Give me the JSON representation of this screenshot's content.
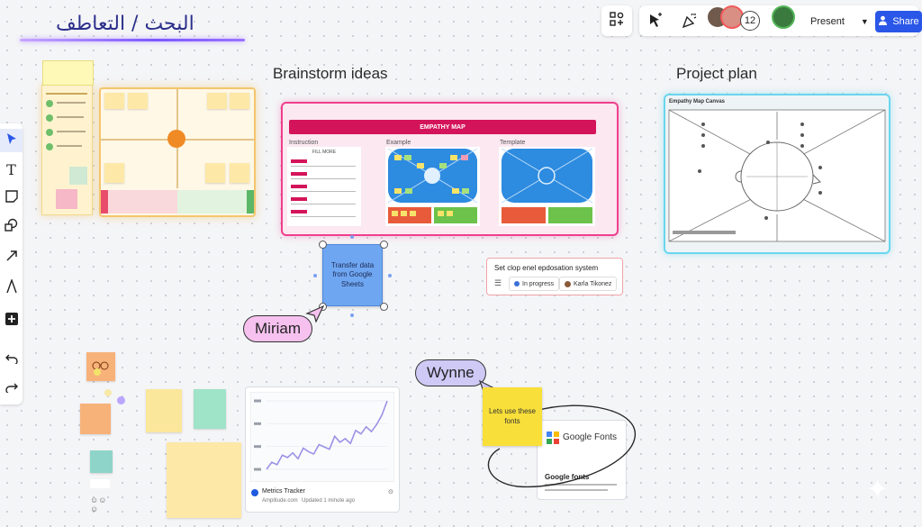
{
  "board": {
    "title": "البحث / التعاطف"
  },
  "toolbar": {
    "participant_count": "12",
    "present_label": "Present",
    "share_label": "Share",
    "icons": [
      "shapes-icon",
      "cursor-select-icon",
      "celebrate-icon"
    ]
  },
  "left_toolbar": {
    "tools": [
      "select-tool",
      "text-tool",
      "sticky-note-tool",
      "shapes-tool",
      "connector-tool",
      "pen-tool",
      "add-tool",
      "undo-tool",
      "redo-tool"
    ]
  },
  "sections": {
    "brainstorm": "Brainstorm ideas",
    "project_plan": "Project plan"
  },
  "empathy_map": {
    "header": "EMPATHY MAP",
    "columns": [
      "Instruction",
      "Example",
      "Template"
    ],
    "fill_more": "FILL MORE"
  },
  "project_canvas": {
    "title": "Empathy Map Canvas"
  },
  "blue_sticky": {
    "text": "Transfer data from Google Sheets"
  },
  "cursors": [
    {
      "name": "Miriam",
      "color": "#f6c1ef"
    },
    {
      "name": "Wynne",
      "color": "#cfc9f6"
    }
  ],
  "task_card": {
    "title": "Set clop enel epdosation system",
    "status": "In progress",
    "assignee": "Karla Tikonez"
  },
  "chart_card": {
    "title": "Metrics Tracker",
    "source": "Amplitude.com",
    "updated": "Updated 1 minute ago"
  },
  "chart_data": {
    "type": "line",
    "x": [
      1,
      2,
      3,
      4,
      5,
      6,
      7,
      8,
      9,
      10,
      11,
      12,
      13,
      14,
      15,
      16,
      17,
      18,
      19,
      20,
      21,
      22,
      23,
      24
    ],
    "series": [
      {
        "values": [
          12,
          18,
          16,
          24,
          22,
          26,
          21,
          30,
          27,
          25,
          33,
          31,
          29,
          40,
          35,
          38,
          34,
          45,
          42,
          48,
          44,
          50,
          58,
          70
        ]
      }
    ],
    "grid": true
  },
  "yellow_sticky": {
    "text": "Lets use these fonts"
  },
  "google_fonts_card": {
    "brand": "Google Fonts",
    "title": "Google fonts"
  },
  "colors": {
    "brainstorm_frame": "#ef3f8e",
    "plan_frame": "#6ad6ef",
    "share": "#2a57e8",
    "orange_dot": "#f08a24"
  }
}
